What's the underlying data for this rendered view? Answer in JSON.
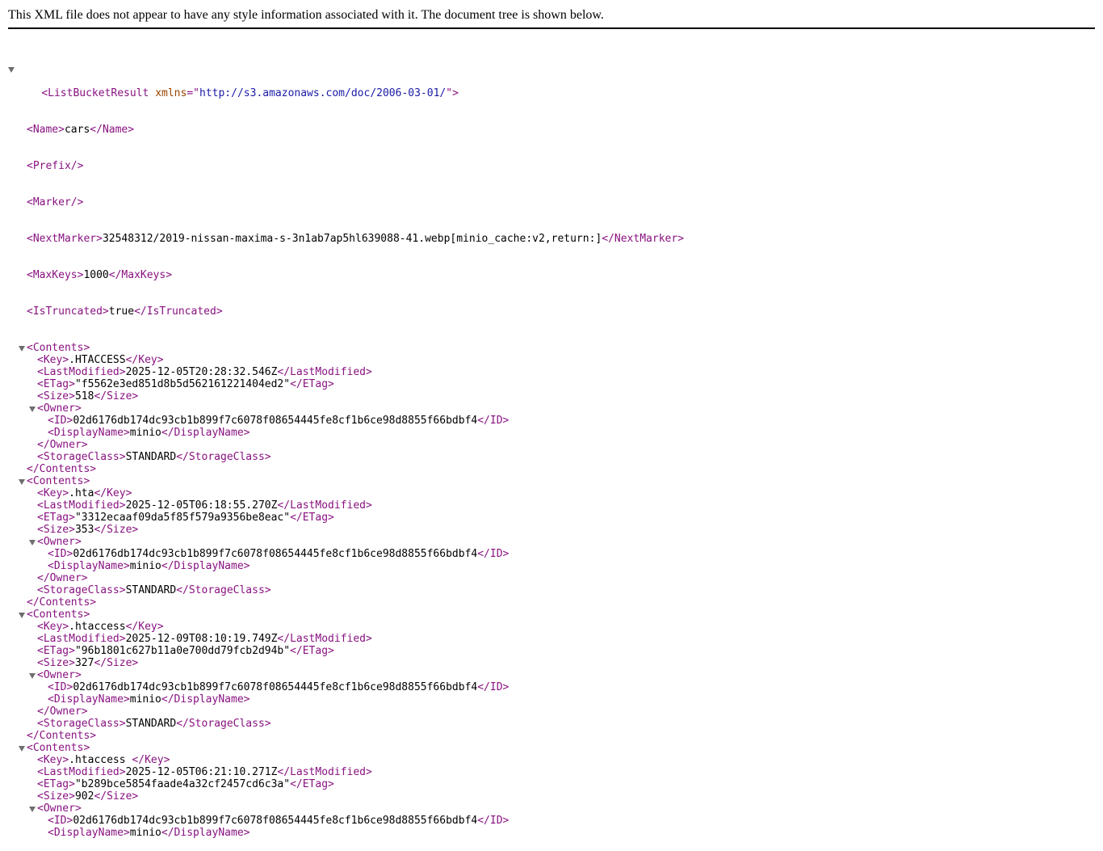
{
  "header": {
    "text": "This XML file does not appear to have any style information associated with it. The document tree is shown below."
  },
  "root": {
    "tag": "ListBucketResult",
    "attr_name": "xmlns",
    "attr_value": "http://s3.amazonaws.com/doc/2006-03-01/",
    "name_tag": "Name",
    "name": "cars",
    "prefix_tag": "Prefix",
    "marker_tag": "Marker",
    "next_marker_tag": "NextMarker",
    "next_marker": "32548312/2019-nissan-maxima-s-3n1ab7ap5hl639088-41.webp[minio_cache:v2,return:]",
    "max_keys_tag": "MaxKeys",
    "max_keys": "1000",
    "is_truncated_tag": "IsTruncated",
    "is_truncated": "true"
  },
  "tags": {
    "contents": "Contents",
    "key": "Key",
    "last_modified": "LastModified",
    "etag": "ETag",
    "size": "Size",
    "owner": "Owner",
    "id": "ID",
    "display_name": "DisplayName",
    "storage_class": "StorageClass"
  },
  "contents": [
    {
      "key": ".HTACCESS",
      "last_modified": "2025-12-05T20:28:32.546Z",
      "etag": "\"f5562e3ed851d8b5d562161221404ed2\"",
      "size": "518",
      "owner_id": "02d6176db174dc93cb1b899f7c6078f08654445fe8cf1b6ce98d8855f66bdbf4",
      "owner_display_name": "minio",
      "storage_class": "STANDARD"
    },
    {
      "key": ".hta",
      "last_modified": "2025-12-05T06:18:55.270Z",
      "etag": "\"3312ecaaf09da5f85f579a9356be8eac\"",
      "size": "353",
      "owner_id": "02d6176db174dc93cb1b899f7c6078f08654445fe8cf1b6ce98d8855f66bdbf4",
      "owner_display_name": "minio",
      "storage_class": "STANDARD"
    },
    {
      "key": ".htaccess",
      "last_modified": "2025-12-09T08:10:19.749Z",
      "etag": "\"96b1801c627b11a0e700dd79fcb2d94b\"",
      "size": "327",
      "owner_id": "02d6176db174dc93cb1b899f7c6078f08654445fe8cf1b6ce98d8855f66bdbf4",
      "owner_display_name": "minio",
      "storage_class": "STANDARD"
    },
    {
      "key": ".htaccess ",
      "last_modified": "2025-12-05T06:21:10.271Z",
      "etag": "\"b289bce5854faade4a32cf2457cd6c3a\"",
      "size": "902",
      "owner_id": "02d6176db174dc93cb1b899f7c6078f08654445fe8cf1b6ce98d8855f66bdbf4",
      "owner_display_name": "minio"
    }
  ]
}
